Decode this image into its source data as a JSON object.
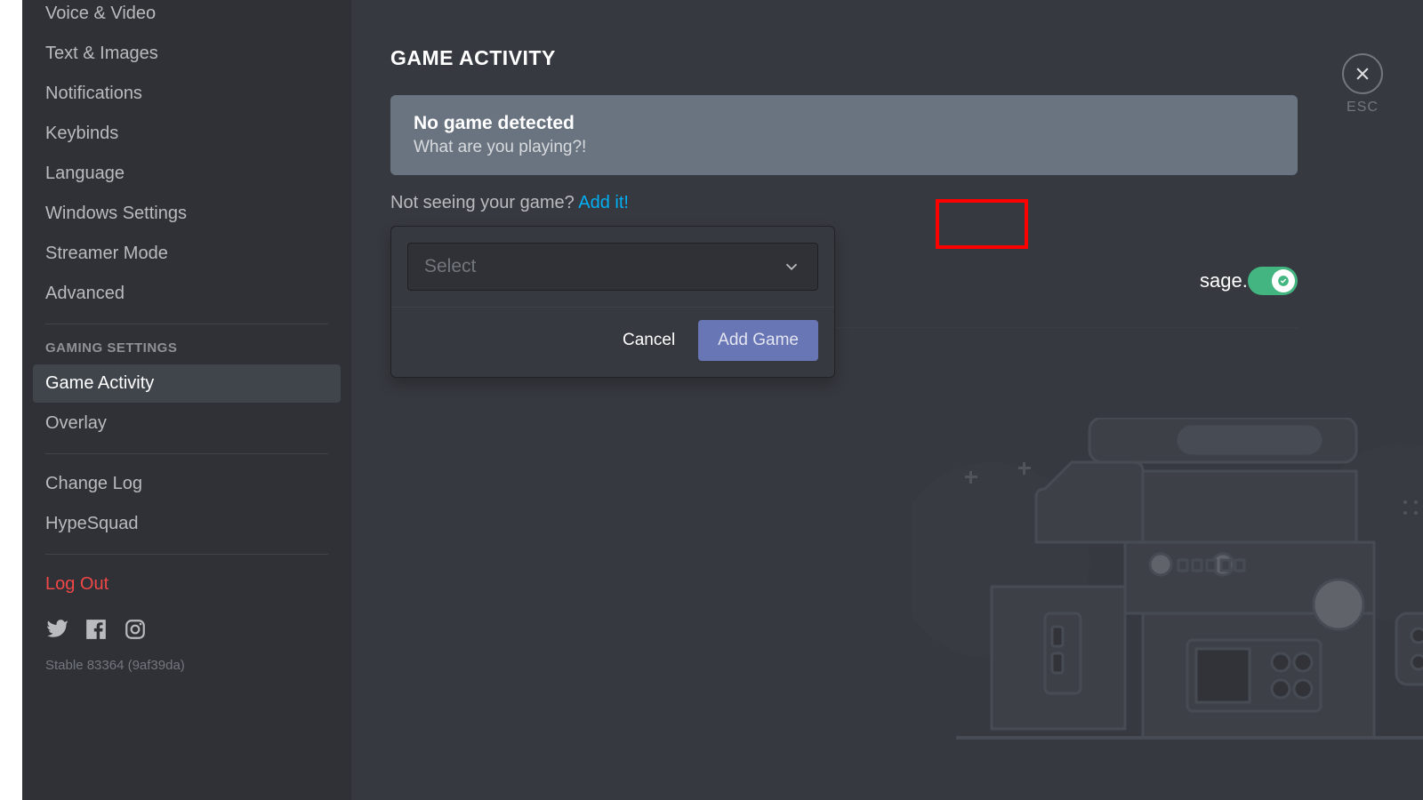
{
  "sidebar": {
    "items_top": [
      "Voice & Video",
      "Text & Images",
      "Notifications",
      "Keybinds",
      "Language",
      "Windows Settings",
      "Streamer Mode",
      "Advanced"
    ],
    "section_gaming": "GAMING SETTINGS",
    "items_gaming": [
      "Game Activity",
      "Overlay"
    ],
    "active_index_gaming": 0,
    "items_misc": [
      "Change Log",
      "HypeSquad"
    ],
    "logout_label": "Log Out",
    "version_text": "Stable 83364 (9af39da)"
  },
  "main": {
    "title": "GAME ACTIVITY",
    "banner": {
      "heading": "No game detected",
      "sub": "What are you playing?!"
    },
    "prompt_text": "Not seeing your game? ",
    "prompt_link": "Add it!",
    "toggle_text_fragment": "sage.",
    "toggle_on": true
  },
  "popup": {
    "select_placeholder": "Select",
    "cancel_label": "Cancel",
    "add_label": "Add Game"
  },
  "close": {
    "label": "ESC"
  }
}
